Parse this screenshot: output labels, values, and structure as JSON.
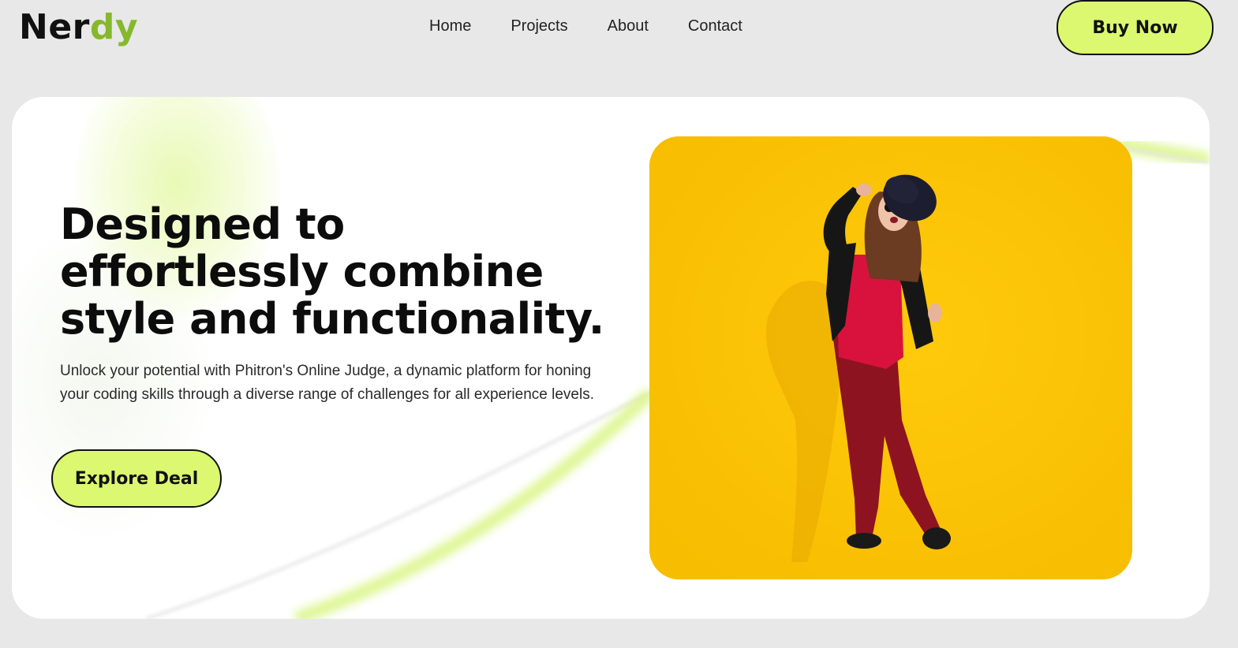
{
  "logo": {
    "prefix": "Ner",
    "accent": "dy"
  },
  "nav": {
    "items": [
      "Home",
      "Projects",
      "About",
      "Contact"
    ],
    "cta": "Buy Now"
  },
  "hero": {
    "headline": "Designed to effortlessly combine style and functionality.",
    "description": "Unlock your potential with Phitron's Online Judge, a dynamic platform for honing your coding skills through a diverse range of challenges for all experience levels.",
    "button": "Explore Deal",
    "image_alt": "Woman in red outfit and black hat posing on yellow background"
  },
  "colors": {
    "accent_green": "#dbf870",
    "logo_accent": "#86b82d",
    "image_bg": "#fdc201",
    "page_bg": "#e8e8e8"
  }
}
